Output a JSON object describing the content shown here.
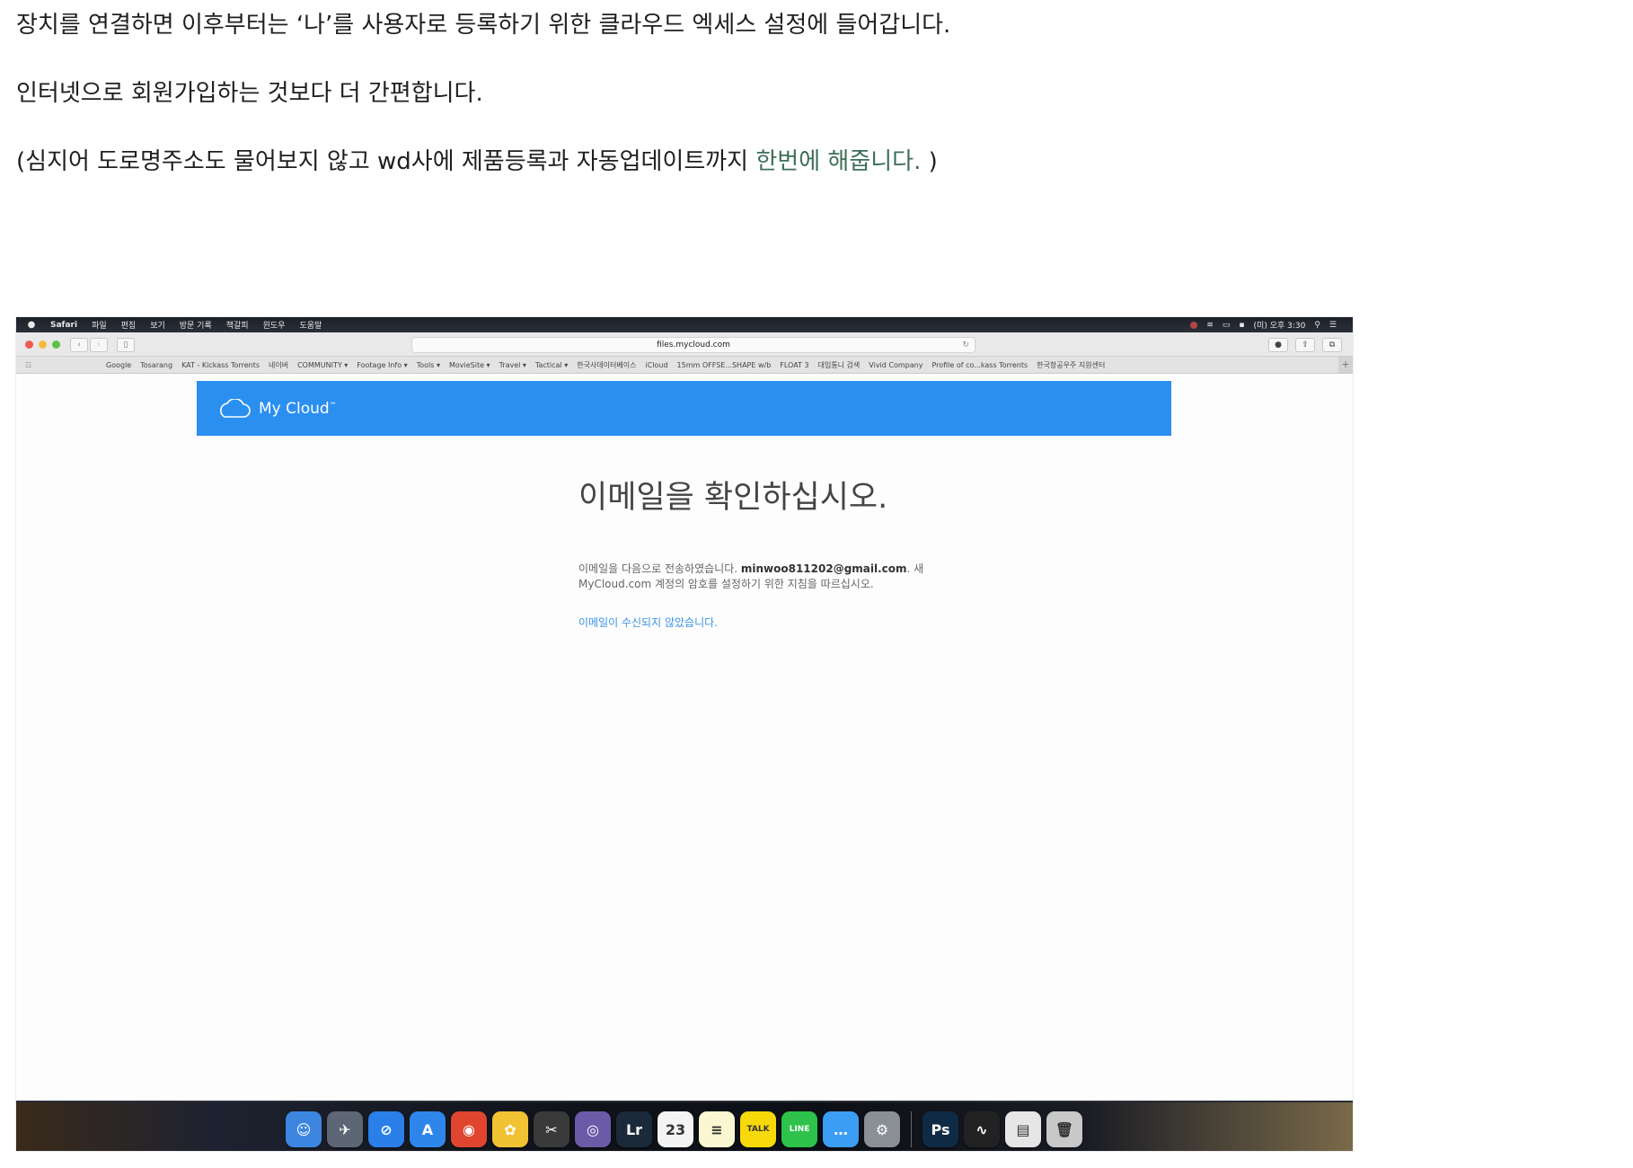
{
  "article": {
    "line1": "장치를 연결하면 이후부터는 ‘나’를 사용자로 등록하기 위한 클라우드 엑세스 설정에 들어갑니다.",
    "line2": "인터넷으로 회원가입하는 것보다 더 간편합니다.",
    "line3_prefix": "(심지어 도로명주소도 물어보지 않고 wd사에 제품등록과 자동업데이트까지 ",
    "line3_link": "한번에 해줍니다.",
    "line3_suffix": " )"
  },
  "menubar": {
    "app_name": "Safari",
    "items": [
      "파일",
      "편집",
      "보기",
      "방문 기록",
      "책갈피",
      "윈도우",
      "도움말"
    ],
    "clock": "(미) 오후 3:30"
  },
  "browser": {
    "url": "files.mycloud.com",
    "bookmarks": [
      "Google",
      "Tosarang",
      "KAT - Kickass Torrents",
      "네이버",
      "COMMUNITY ▾",
      "Footage Info ▾",
      "Tools ▾",
      "MovieSite ▾",
      "Travel ▾",
      "Tactical ▾",
      "한국사데이터베이스",
      "iCloud",
      "15mm OFFSE...SHAPE w/b",
      "FLOAT 3",
      "대입통니 검색",
      "Vivid Company",
      "Profile of co...kass Torrents",
      "한국항공우주 지원센터"
    ]
  },
  "mycloud": {
    "brand": "My Cloud",
    "brand_tm": "™",
    "title": "이메일을 확인하십시오.",
    "body_line1_prefix": "이메일을 다음으로 전송하였습니다. ",
    "email": "minwoo811202@gmail.com",
    "body_line1_suffix": ". 새",
    "body_line2": "MyCloud.com 계정의 암호를 설정하기 위한 지침을 따르십시오.",
    "not_received_link": "이메일이 수신되지 않았습니다."
  },
  "dock": {
    "icons": [
      {
        "name": "finder-icon",
        "color": "#3d86e0",
        "glyph": "☺"
      },
      {
        "name": "launchpad-icon",
        "color": "#5d6675",
        "glyph": "✈"
      },
      {
        "name": "safari-icon",
        "color": "#2a7fe8",
        "glyph": "⊘"
      },
      {
        "name": "app-store-icon",
        "color": "#2e86ea",
        "glyph": "A"
      },
      {
        "name": "chrome-icon",
        "color": "#e0452f",
        "glyph": "◉"
      },
      {
        "name": "photos-icon",
        "color": "#f1c232",
        "glyph": "✿"
      },
      {
        "name": "final-cut-icon",
        "color": "#3a3a3a",
        "glyph": "✂"
      },
      {
        "name": "motion-icon",
        "color": "#6b5aa8",
        "glyph": "◎"
      },
      {
        "name": "lightroom-icon",
        "color": "#1b2a3a",
        "glyph": "Lr"
      },
      {
        "name": "calendar-icon",
        "color": "#f4f4f4",
        "glyph": "23"
      },
      {
        "name": "notes-icon",
        "color": "#fbf7d2",
        "glyph": "≡"
      },
      {
        "name": "kakaotalk-icon",
        "color": "#f7d90a",
        "glyph": "TALK"
      },
      {
        "name": "line-icon",
        "color": "#2ec24a",
        "glyph": "LINE"
      },
      {
        "name": "messages-icon",
        "color": "#3b9df3",
        "glyph": "…"
      },
      {
        "name": "system-preferences-icon",
        "color": "#8a8f96",
        "glyph": "⚙"
      },
      {
        "name": "photoshop-icon",
        "color": "#0f2a44",
        "glyph": "Ps"
      },
      {
        "name": "activity-monitor-icon",
        "color": "#222",
        "glyph": "∿"
      },
      {
        "name": "preview-icon",
        "color": "#e6e6e6",
        "glyph": "▤"
      },
      {
        "name": "trash-icon",
        "color": "#c8c8c8",
        "glyph": "🗑"
      }
    ]
  }
}
